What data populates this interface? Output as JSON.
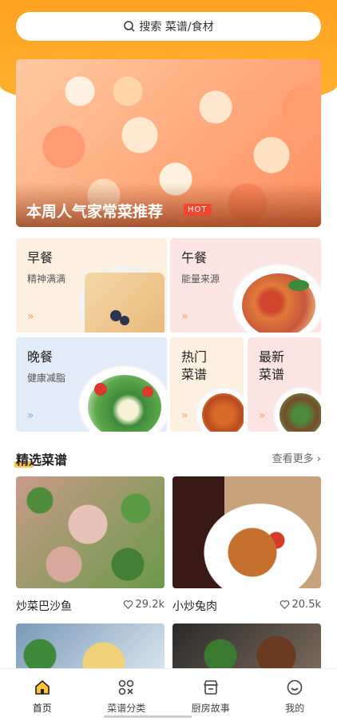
{
  "search": {
    "placeholder": "搜索 菜谱/食材"
  },
  "banner": {
    "title": "本周人气家常菜推荐",
    "badge": "HOT"
  },
  "categories": [
    {
      "title": "早餐",
      "subtitle": "精神满满"
    },
    {
      "title": "午餐",
      "subtitle": "能量来源"
    },
    {
      "title": "晚餐",
      "subtitle": "健康减脂"
    },
    {
      "title": "热门\n菜谱"
    },
    {
      "title": "最新\n菜谱"
    }
  ],
  "section": {
    "title": "精选菜谱",
    "more": "查看更多 ›"
  },
  "recipes": [
    {
      "name": "炒菜巴沙鱼",
      "likes": "29.2k"
    },
    {
      "name": "小炒兔肉",
      "likes": "20.5k"
    }
  ],
  "tabs": [
    {
      "label": "首页",
      "icon": "home-icon"
    },
    {
      "label": "菜谱分类",
      "icon": "grid-icon"
    },
    {
      "label": "厨房故事",
      "icon": "shop-icon"
    },
    {
      "label": "我的",
      "icon": "smile-icon"
    }
  ],
  "colors": {
    "accent": "#ffa21f",
    "hot": "#f0472f"
  }
}
